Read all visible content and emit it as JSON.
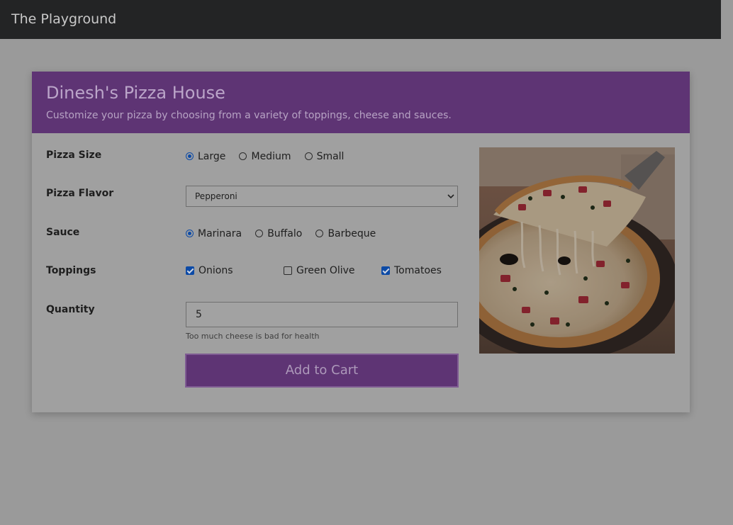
{
  "navbar": {
    "brand": "The Playground"
  },
  "card": {
    "title": "Dinesh's Pizza House",
    "subtitle": "Customize your pizza by choosing from a variety of toppings, cheese and sauces."
  },
  "form": {
    "size": {
      "label": "Pizza Size",
      "options": [
        "Large",
        "Medium",
        "Small"
      ],
      "selected": "Large"
    },
    "flavor": {
      "label": "Pizza Flavor",
      "selected": "Pepperoni"
    },
    "sauce": {
      "label": "Sauce",
      "options": [
        "Marinara",
        "Buffalo",
        "Barbeque"
      ],
      "selected": "Marinara"
    },
    "toppings": {
      "label": "Toppings",
      "options": [
        "Onions",
        "Green Olive",
        "Tomatoes"
      ],
      "checked": [
        true,
        false,
        true
      ]
    },
    "quantity": {
      "label": "Quantity",
      "value": "5",
      "help": "Too much cheese is bad for health"
    },
    "add_to_cart_label": "Add to Cart"
  },
  "icons": {
    "flavor_dropdown": "chevron-down-icon"
  },
  "colors": {
    "header_bg": "#5e3474",
    "navbar_bg": "#232425",
    "accent_blue": "#0c4aa6"
  }
}
